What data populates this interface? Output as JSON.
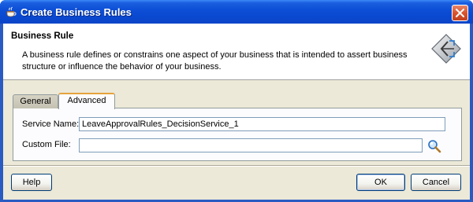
{
  "window": {
    "title": "Create Business Rules",
    "icon": "coffee-cup-icon",
    "close_icon": "close-icon"
  },
  "header": {
    "title": "Business Rule",
    "description": "A business rule defines or constrains one aspect of your business that is intended to assert business structure or influence the behavior of your business.",
    "icon": "business-rule-icon"
  },
  "tabs": [
    {
      "label": "General",
      "selected": false
    },
    {
      "label": "Advanced",
      "selected": true
    }
  ],
  "form": {
    "service_name_label": "Service Name:",
    "service_name_value": "LeaveApprovalRules_DecisionService_1",
    "custom_file_label": "Custom File:",
    "custom_file_value": "",
    "search_icon": "magnifier-icon"
  },
  "buttons": {
    "help": "Help",
    "ok": "OK",
    "cancel": "Cancel"
  },
  "colors": {
    "titlebar": "#0a48d0",
    "dialog_bg": "#ece9d8",
    "tab_accent": "#e6a33c"
  }
}
